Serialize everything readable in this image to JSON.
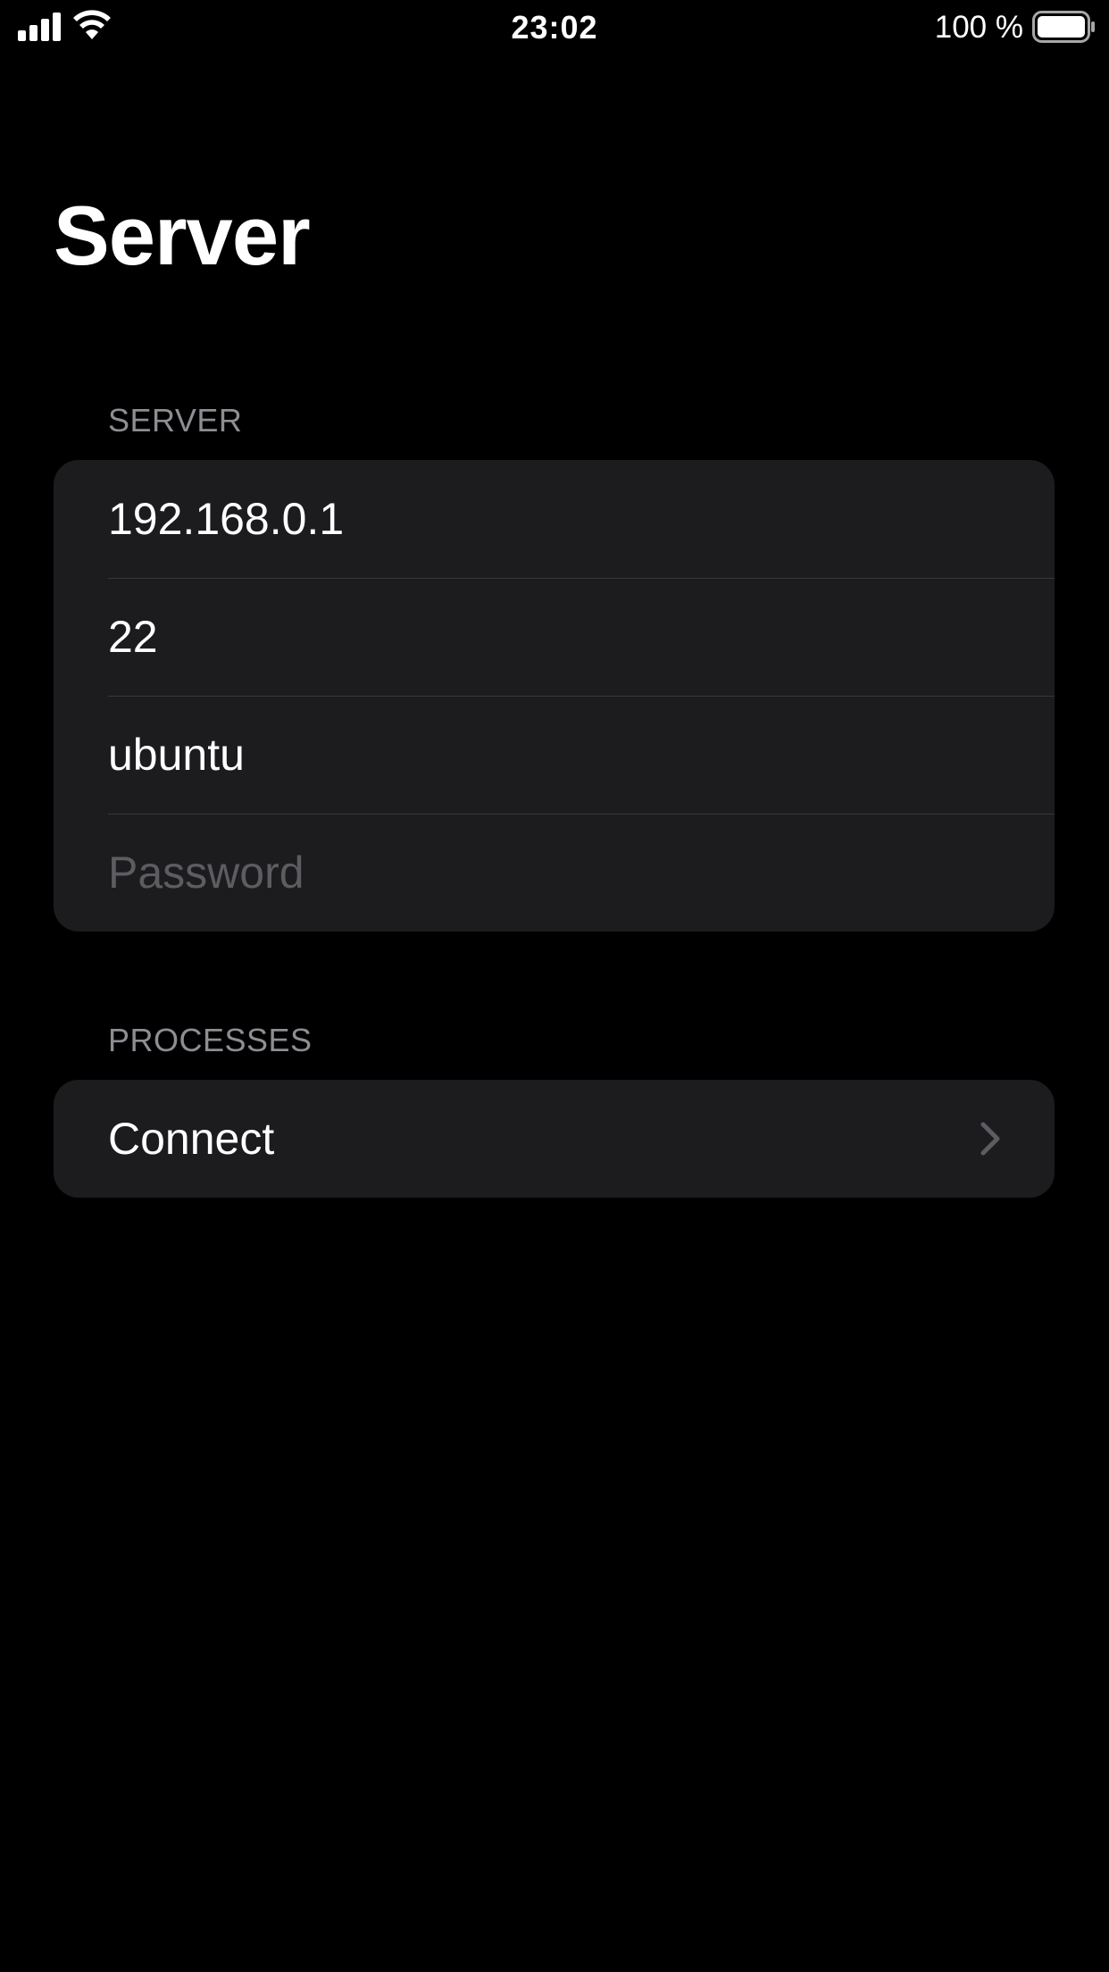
{
  "status_bar": {
    "time": "23:02",
    "battery_percent": "100 %",
    "signal_bars": 4,
    "icons": [
      "cellular-signal-icon",
      "wifi-icon",
      "battery-icon"
    ]
  },
  "page": {
    "title": "Server"
  },
  "server_section": {
    "header": "SERVER",
    "host_value": "192.168.0.1",
    "port_value": "22",
    "username_value": "ubuntu",
    "password_placeholder": "Password"
  },
  "processes_section": {
    "header": "PROCESSES",
    "connect_label": "Connect",
    "connect_icon": "chevron-right-icon"
  },
  "colors": {
    "background": "#000000",
    "card": "#1c1c1e",
    "section_header": "#8d8d93",
    "placeholder": "#5c5c61",
    "separator": "#38383a",
    "chevron": "#5c5c61"
  }
}
